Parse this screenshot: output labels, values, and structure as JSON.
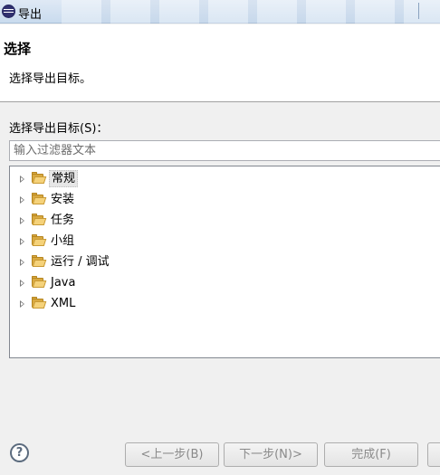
{
  "window": {
    "title": "导出",
    "icon": "eclipse-icon"
  },
  "header": {
    "title": "选择",
    "description": "选择导出目标。"
  },
  "filter": {
    "label": "选择导出目标(S)：",
    "placeholder": "输入过滤器文本"
  },
  "tree": {
    "items": [
      {
        "label": "常规",
        "icon": "folder-icon",
        "selected": true
      },
      {
        "label": "安装",
        "icon": "folder-icon"
      },
      {
        "label": "任务",
        "icon": "folder-icon"
      },
      {
        "label": "小组",
        "icon": "folder-icon"
      },
      {
        "label": "运行 / 调试",
        "icon": "folder-icon"
      },
      {
        "label": "Java",
        "icon": "folder-icon"
      },
      {
        "label": "XML",
        "icon": "folder-icon"
      }
    ]
  },
  "footer": {
    "help": "?",
    "back_label": "<上一步(B)",
    "next_label": "下一步(N)>",
    "finish_label": "完成(F)"
  }
}
